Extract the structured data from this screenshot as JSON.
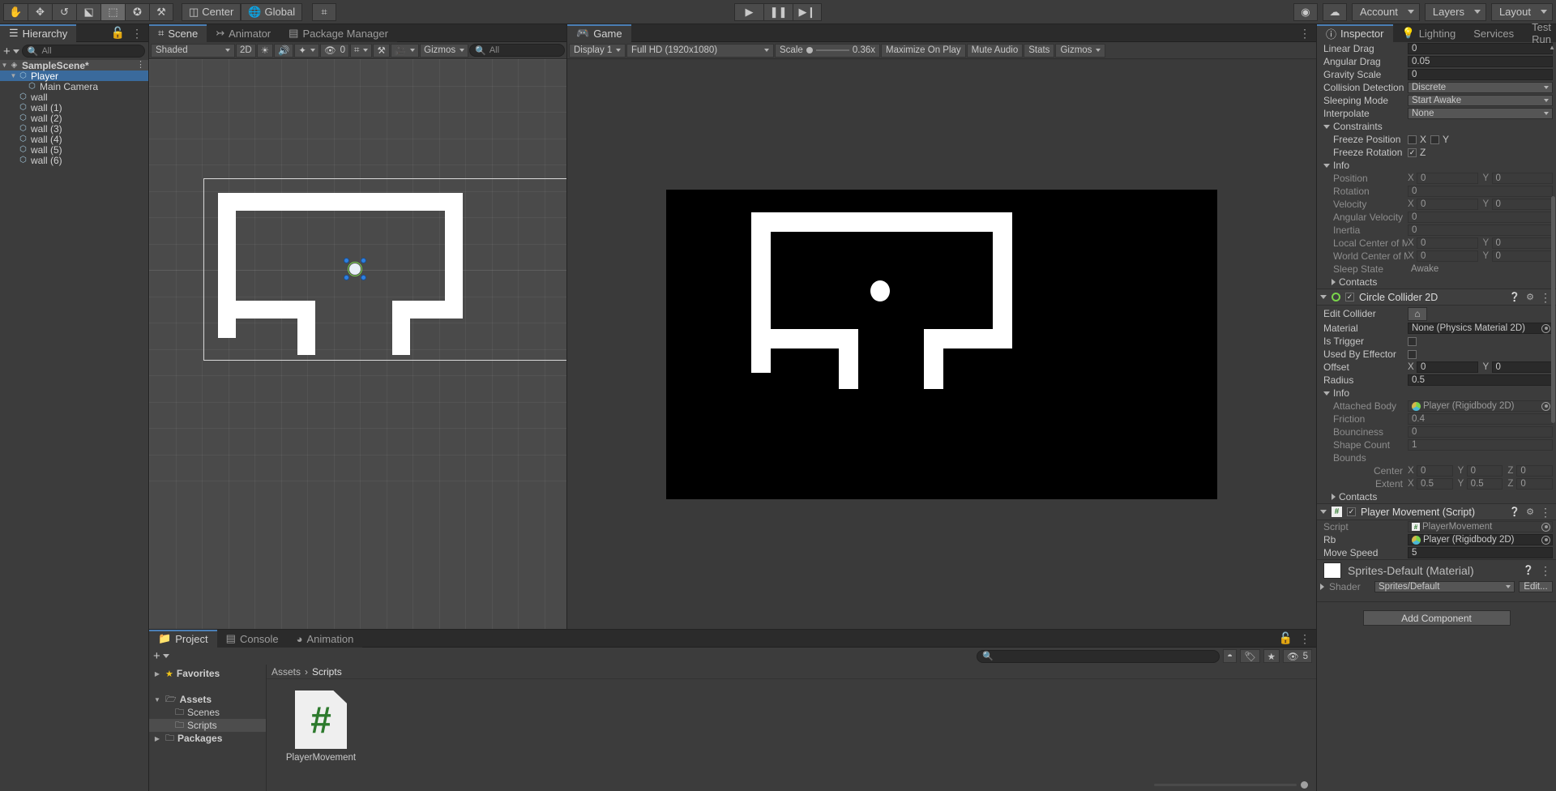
{
  "toolbar": {
    "tools": [
      {
        "name": "hand-tool-icon",
        "glyph": "✋"
      },
      {
        "name": "move-tool-icon",
        "glyph": "✥"
      },
      {
        "name": "rotate-tool-icon",
        "glyph": "↺"
      },
      {
        "name": "scale-tool-icon",
        "glyph": "⤢"
      },
      {
        "name": "rect-tool-icon",
        "glyph": "⬚"
      },
      {
        "name": "transform-tool-icon",
        "glyph": "✪"
      },
      {
        "name": "custom-tool-icon",
        "glyph": "⚒"
      }
    ],
    "pivot_label": "Center",
    "handle_label": "Global",
    "snap_icon": "grid-snap-icon",
    "play_label": "▶",
    "pause_label": "❚❚",
    "step_label": "▶❙",
    "collab_icon": "collab-icon",
    "cloud_icon": "cloud-icon",
    "account_label": "Account",
    "layers_label": "Layers",
    "layout_label": "Layout"
  },
  "hierarchy": {
    "tab_label": "Hierarchy",
    "search_placeholder": "All",
    "add_label": "+",
    "items": [
      {
        "label": "SampleScene*",
        "depth": 0,
        "type": "scene",
        "expanded": true,
        "selected": false
      },
      {
        "label": "Player",
        "depth": 1,
        "type": "gameobject",
        "expanded": true,
        "selected": true
      },
      {
        "label": "Main Camera",
        "depth": 2,
        "type": "gameobject",
        "expanded": false,
        "selected": false
      },
      {
        "label": "wall",
        "depth": 1,
        "type": "gameobject",
        "expanded": false,
        "selected": false
      },
      {
        "label": "wall (1)",
        "depth": 1,
        "type": "gameobject",
        "expanded": false,
        "selected": false
      },
      {
        "label": "wall (2)",
        "depth": 1,
        "type": "gameobject",
        "expanded": false,
        "selected": false
      },
      {
        "label": "wall (3)",
        "depth": 1,
        "type": "gameobject",
        "expanded": false,
        "selected": false
      },
      {
        "label": "wall (4)",
        "depth": 1,
        "type": "gameobject",
        "expanded": false,
        "selected": false
      },
      {
        "label": "wall (5)",
        "depth": 1,
        "type": "gameobject",
        "expanded": false,
        "selected": false
      },
      {
        "label": "wall (6)",
        "depth": 1,
        "type": "gameobject",
        "expanded": false,
        "selected": false
      }
    ]
  },
  "scene_view": {
    "tabs": [
      {
        "label": "Scene",
        "icon": "grid-icon",
        "active": true
      },
      {
        "label": "Animator",
        "icon": "animator-icon",
        "active": false
      },
      {
        "label": "Package Manager",
        "icon": "package-icon",
        "active": false
      }
    ],
    "draw_mode": "Shaded",
    "mode_2d": "2D",
    "lighting_icon": "lighting-icon",
    "audio_icon": "audio-icon",
    "fx_icon": "fx-icon",
    "hidden_count": "0",
    "grid_icon": "scene-grid-icon",
    "tools_icon": "scene-tools-icon",
    "camera_icon": "scene-camera-icon",
    "gizmos_label": "Gizmos",
    "search_placeholder": "All"
  },
  "game_view": {
    "tab_label": "Game",
    "display": "Display 1",
    "resolution": "Full HD (1920x1080)",
    "scale_label": "Scale",
    "scale_value": "0.36x",
    "maximize_label": "Maximize On Play",
    "mute_label": "Mute Audio",
    "stats_label": "Stats",
    "gizmos_label": "Gizmos"
  },
  "project": {
    "tabs": [
      {
        "label": "Project",
        "icon": "folder-icon",
        "active": true
      },
      {
        "label": "Console",
        "icon": "console-icon",
        "active": false
      },
      {
        "label": "Animation",
        "icon": "clock-icon",
        "active": false
      }
    ],
    "add_label": "+",
    "search_placeholder": "",
    "filter_count": "5",
    "tree": [
      {
        "label": "Favorites",
        "depth": 0,
        "arrow": "right",
        "icon": "star-icon",
        "selected": false
      },
      {
        "label": "",
        "depth": 0,
        "arrow": "none",
        "icon": "none",
        "selected": false
      },
      {
        "label": "Assets",
        "depth": 0,
        "arrow": "down",
        "icon": "folder-open-icon",
        "selected": false
      },
      {
        "label": "Scenes",
        "depth": 1,
        "arrow": "none",
        "icon": "folder-icon",
        "selected": false
      },
      {
        "label": "Scripts",
        "depth": 1,
        "arrow": "none",
        "icon": "folder-icon",
        "selected": true
      },
      {
        "label": "Packages",
        "depth": 0,
        "arrow": "right",
        "icon": "folder-icon",
        "selected": false
      }
    ],
    "breadcrumb": [
      "Assets",
      "Scripts"
    ],
    "assets": [
      {
        "label": "PlayerMovement",
        "type": "csharp-script",
        "glyph": "#"
      }
    ]
  },
  "inspector": {
    "tabs": [
      {
        "label": "Inspector",
        "icon": "info-icon",
        "active": true
      },
      {
        "label": "Lighting",
        "icon": "bulb-icon",
        "active": false
      },
      {
        "label": "Services",
        "icon": "none",
        "active": false
      },
      {
        "label": "Test Run",
        "icon": "none",
        "active": false
      }
    ],
    "rigidbody": {
      "rows": [
        {
          "label": "Linear Drag",
          "value": "0",
          "kind": "text"
        },
        {
          "label": "Angular Drag",
          "value": "0.05",
          "kind": "text"
        },
        {
          "label": "Gravity Scale",
          "value": "0",
          "kind": "text"
        },
        {
          "label": "Collision Detection",
          "value": "Discrete",
          "kind": "popup"
        },
        {
          "label": "Sleeping Mode",
          "value": "Start Awake",
          "kind": "popup"
        },
        {
          "label": "Interpolate",
          "value": "None",
          "kind": "popup"
        }
      ],
      "constraints_label": "Constraints",
      "freeze_position_label": "Freeze Position",
      "freeze_position_x": {
        "axis": "X",
        "checked": false
      },
      "freeze_position_y": {
        "axis": "Y",
        "checked": false
      },
      "freeze_rotation_label": "Freeze Rotation",
      "freeze_rotation_z": {
        "axis": "Z",
        "checked": true
      },
      "info_label": "Info",
      "info_rows": [
        {
          "label": "Position",
          "kind": "xy",
          "x": "0",
          "y": "0"
        },
        {
          "label": "Rotation",
          "kind": "text",
          "value": "0"
        },
        {
          "label": "Velocity",
          "kind": "xy",
          "x": "0",
          "y": "0"
        },
        {
          "label": "Angular Velocity",
          "kind": "text",
          "value": "0"
        },
        {
          "label": "Inertia",
          "kind": "text",
          "value": "0"
        },
        {
          "label": "Local Center of Mass",
          "kind": "xy",
          "x": "0",
          "y": "0"
        },
        {
          "label": "World Center of Mass",
          "kind": "xy",
          "x": "0",
          "y": "0"
        },
        {
          "label": "Sleep State",
          "kind": "plain",
          "value": "Awake"
        }
      ],
      "contacts_label": "Contacts"
    },
    "circle_collider": {
      "title": "Circle Collider 2D",
      "enabled": true,
      "edit_collider_label": "Edit Collider",
      "material_label": "Material",
      "material_value": "None (Physics Material 2D)",
      "is_trigger_label": "Is Trigger",
      "is_trigger_checked": false,
      "used_by_effector_label": "Used By Effector",
      "used_by_effector_checked": false,
      "offset_label": "Offset",
      "offset_x": "0",
      "offset_y": "0",
      "radius_label": "Radius",
      "radius_value": "0.5",
      "info_label": "Info",
      "attached_body_label": "Attached Body",
      "attached_body_value": "Player (Rigidbody 2D)",
      "friction_label": "Friction",
      "friction_value": "0.4",
      "bounciness_label": "Bounciness",
      "bounciness_value": "0",
      "shape_count_label": "Shape Count",
      "shape_count_value": "1",
      "bounds_label": "Bounds",
      "bounds_center_label": "Center",
      "bounds_center": {
        "x": "0",
        "y": "0",
        "z": "0"
      },
      "bounds_extent_label": "Extent",
      "bounds_extent": {
        "x": "0.5",
        "y": "0.5",
        "z": "0"
      },
      "contacts_label": "Contacts"
    },
    "player_movement": {
      "title": "Player Movement (Script)",
      "enabled": true,
      "script_label": "Script",
      "script_value": "PlayerMovement",
      "rb_label": "Rb",
      "rb_value": "Player (Rigidbody 2D)",
      "move_speed_label": "Move Speed",
      "move_speed_value": "5"
    },
    "material": {
      "title": "Sprites-Default (Material)",
      "shader_label": "Shader",
      "shader_value": "Sprites/Default",
      "edit_label": "Edit..."
    },
    "add_component_label": "Add Component"
  },
  "colors": {
    "accent_blue": "#3a6a9c",
    "panel_bg": "#3c3c3c",
    "toolbar_bg": "#3c3c3c",
    "tab_bg": "#2b2b2b",
    "field_bg": "#2a2a2a",
    "scene_bg": "#4a4a4a",
    "game_bg": "#000000",
    "wall_color": "#ffffff",
    "script_green": "#2d7a2d",
    "collider_green": "#7ad44b",
    "star_yellow": "#f0c419"
  }
}
